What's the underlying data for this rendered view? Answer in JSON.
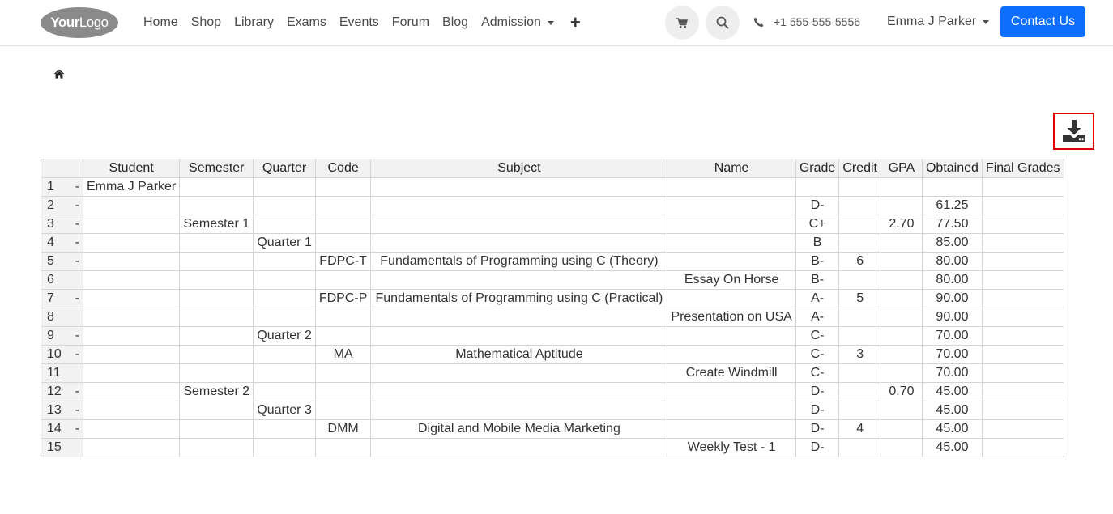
{
  "navbar": {
    "logo": {
      "bold": "Your",
      "light": "Logo"
    },
    "menu": [
      "Home",
      "Shop",
      "Library",
      "Exams",
      "Events",
      "Forum",
      "Blog",
      "Admission"
    ],
    "plus": "+",
    "phone": "+1 555-555-5556",
    "user": "Emma J Parker",
    "contact": "Contact Us"
  },
  "colors": {
    "accent": "#0d6efd",
    "highlight_border": "#e00000"
  },
  "table": {
    "headers": [
      "",
      "Student",
      "Semester",
      "Quarter",
      "Code",
      "Subject",
      "Name",
      "Grade",
      "Credit",
      "GPA",
      "Obtained",
      "Final Grades"
    ],
    "rows": [
      {
        "num": "1",
        "dash": "-",
        "student": "Emma J Parker",
        "semester": "",
        "quarter": "",
        "code": "",
        "subject": "",
        "name": "",
        "grade": "",
        "credit": "",
        "gpa": "",
        "obtained": "",
        "final": ""
      },
      {
        "num": "2",
        "dash": "-",
        "student": "",
        "semester": "",
        "quarter": "",
        "code": "",
        "subject": "",
        "name": "",
        "grade": "D-",
        "credit": "",
        "gpa": "",
        "obtained": "61.25",
        "final": ""
      },
      {
        "num": "3",
        "dash": "-",
        "student": "",
        "semester": "Semester 1",
        "quarter": "",
        "code": "",
        "subject": "",
        "name": "",
        "grade": "C+",
        "credit": "",
        "gpa": "2.70",
        "obtained": "77.50",
        "final": ""
      },
      {
        "num": "4",
        "dash": "-",
        "student": "",
        "semester": "",
        "quarter": "Quarter 1",
        "code": "",
        "subject": "",
        "name": "",
        "grade": "B",
        "credit": "",
        "gpa": "",
        "obtained": "85.00",
        "final": ""
      },
      {
        "num": "5",
        "dash": "-",
        "student": "",
        "semester": "",
        "quarter": "",
        "code": "FDPC-T",
        "subject": "Fundamentals of Programming using C (Theory)",
        "name": "",
        "grade": "B-",
        "credit": "6",
        "gpa": "",
        "obtained": "80.00",
        "final": ""
      },
      {
        "num": "6",
        "dash": "",
        "student": "",
        "semester": "",
        "quarter": "",
        "code": "",
        "subject": "",
        "name": "Essay On Horse",
        "grade": "B-",
        "credit": "",
        "gpa": "",
        "obtained": "80.00",
        "final": ""
      },
      {
        "num": "7",
        "dash": "-",
        "student": "",
        "semester": "",
        "quarter": "",
        "code": "FDPC-P",
        "subject": "Fundamentals of Programming using C (Practical)",
        "name": "",
        "grade": "A-",
        "credit": "5",
        "gpa": "",
        "obtained": "90.00",
        "final": ""
      },
      {
        "num": "8",
        "dash": "",
        "student": "",
        "semester": "",
        "quarter": "",
        "code": "",
        "subject": "",
        "name": "Presentation on USA",
        "grade": "A-",
        "credit": "",
        "gpa": "",
        "obtained": "90.00",
        "final": ""
      },
      {
        "num": "9",
        "dash": "-",
        "student": "",
        "semester": "",
        "quarter": "Quarter 2",
        "code": "",
        "subject": "",
        "name": "",
        "grade": "C-",
        "credit": "",
        "gpa": "",
        "obtained": "70.00",
        "final": ""
      },
      {
        "num": "10",
        "dash": "-",
        "student": "",
        "semester": "",
        "quarter": "",
        "code": "MA",
        "subject": "Mathematical Aptitude",
        "name": "",
        "grade": "C-",
        "credit": "3",
        "gpa": "",
        "obtained": "70.00",
        "final": ""
      },
      {
        "num": "11",
        "dash": "",
        "student": "",
        "semester": "",
        "quarter": "",
        "code": "",
        "subject": "",
        "name": "Create Windmill",
        "grade": "C-",
        "credit": "",
        "gpa": "",
        "obtained": "70.00",
        "final": ""
      },
      {
        "num": "12",
        "dash": "-",
        "student": "",
        "semester": "Semester 2",
        "quarter": "",
        "code": "",
        "subject": "",
        "name": "",
        "grade": "D-",
        "credit": "",
        "gpa": "0.70",
        "obtained": "45.00",
        "final": ""
      },
      {
        "num": "13",
        "dash": "-",
        "student": "",
        "semester": "",
        "quarter": "Quarter 3",
        "code": "",
        "subject": "",
        "name": "",
        "grade": "D-",
        "credit": "",
        "gpa": "",
        "obtained": "45.00",
        "final": ""
      },
      {
        "num": "14",
        "dash": "-",
        "student": "",
        "semester": "",
        "quarter": "",
        "code": "DMM",
        "subject": "Digital and Mobile Media Marketing",
        "name": "",
        "grade": "D-",
        "credit": "4",
        "gpa": "",
        "obtained": "45.00",
        "final": ""
      },
      {
        "num": "15",
        "dash": "",
        "student": "",
        "semester": "",
        "quarter": "",
        "code": "",
        "subject": "",
        "name": "Weekly Test - 1",
        "grade": "D-",
        "credit": "",
        "gpa": "",
        "obtained": "45.00",
        "final": ""
      }
    ]
  }
}
